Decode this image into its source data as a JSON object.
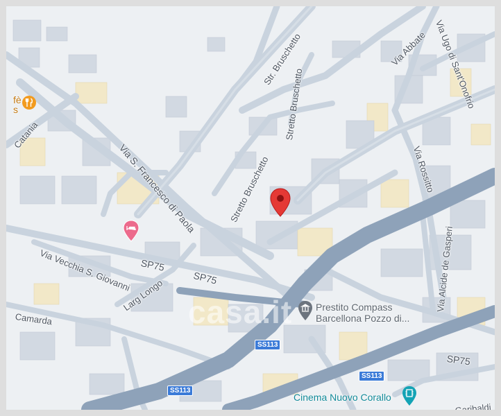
{
  "map": {
    "streets": {
      "via_ugo": "Via Ugo di Sant'Onofrio",
      "via_abbate": "Via Abbate",
      "str_bruschetto": "Str. Bruschetto",
      "stretto_bruschetto_a": "Stretto Bruschetto",
      "stretto_bruschetto_b": "Stretto Bruschetto",
      "via_san_francesco": "Via S. Francesco di Paola",
      "via_rossitto": "Via Rossitto",
      "via_alcide": "Via Alcide de Gasperi",
      "catania": "Catania",
      "via_vecchia": "Via Vecchia S. Giovanni",
      "larg_longo": "Larg Longo",
      "camarda": "Camarda",
      "sp75_a": "SP75",
      "sp75_b": "SP75",
      "sp75_c": "SP75",
      "garibaldi": "Garibaldi"
    },
    "shields": {
      "ss113_a": "SS113",
      "ss113_b": "SS113",
      "ss113_c": "SS113"
    },
    "pois": {
      "prestito_line1": "Prestito Compass",
      "prestito_line2": "Barcellona Pozzo di...",
      "cinema": "Cinema Nuovo Corallo",
      "cafe_fragment_1": "fè",
      "cafe_fragment_2": "s"
    },
    "watermark": "casa.it",
    "colors": {
      "pin": "#e53935",
      "hotel": "#ec6a8c",
      "restaurant": "#f29b1f",
      "cinema": "#13a3b5",
      "bank": "#5f6770",
      "shield": "#3b7bd8"
    }
  }
}
